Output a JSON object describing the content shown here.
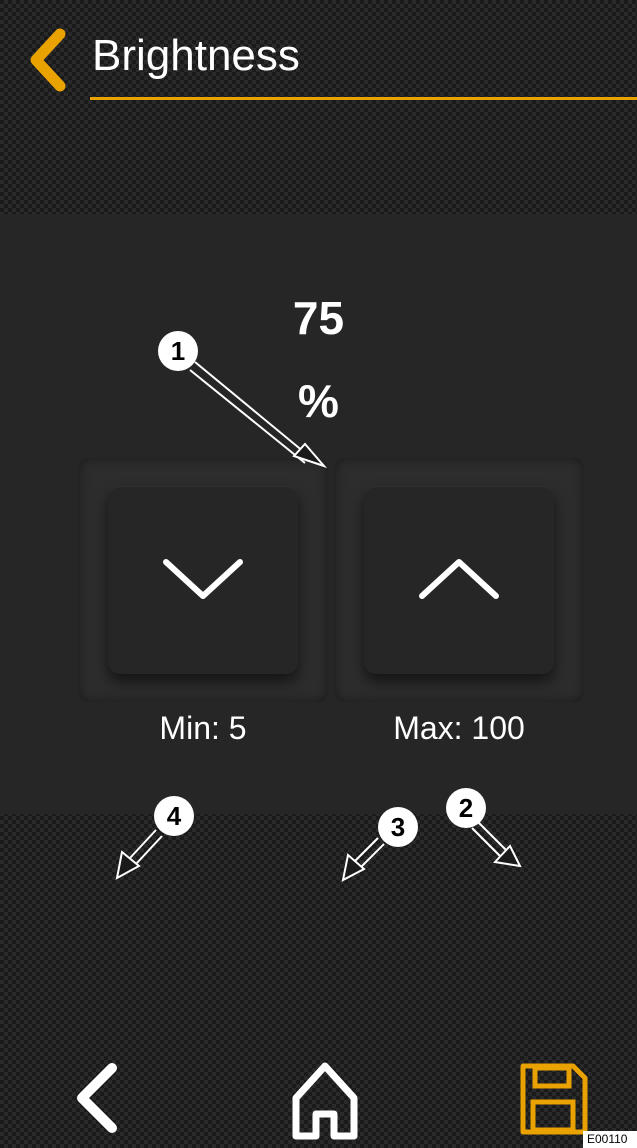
{
  "header": {
    "title": "Brightness",
    "back_icon": "chevron-left-icon"
  },
  "brightness": {
    "value": "75",
    "unit": "%",
    "min_label": "Min: 5",
    "max_label": "Max: 100"
  },
  "buttons": {
    "decrease_icon": "chevron-down-icon",
    "increase_icon": "chevron-up-icon"
  },
  "nav": {
    "back_icon": "chevron-left-icon",
    "home_icon": "home-icon",
    "save_icon": "save-icon"
  },
  "callouts": [
    "1",
    "2",
    "3",
    "4"
  ],
  "figure_code": "E00110",
  "colors": {
    "accent": "#e9a200",
    "panel": "#262626",
    "text": "#ffffff"
  }
}
